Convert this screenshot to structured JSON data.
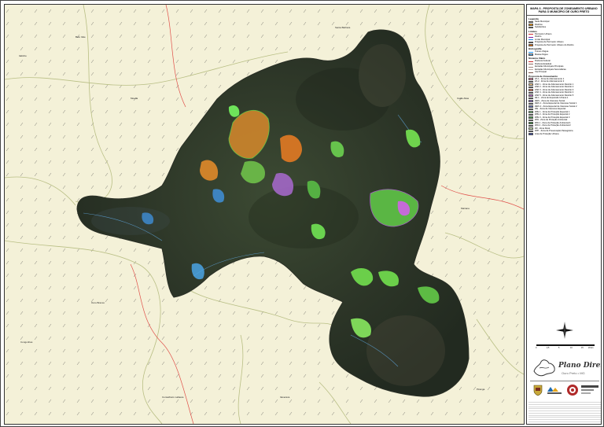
{
  "panel": {
    "title_line1": "MAPA 3 - PROPOSTA DE ZONEAMENTO URBANO",
    "title_line2": "PARA O MUNICÍPIO DE OURO PRETO"
  },
  "legend": {
    "sections": [
      {
        "head": "Legenda",
        "items": [
          {
            "label": "Sede Municipal",
            "color": "#e53935",
            "kind": "box"
          },
          {
            "label": "Distritos",
            "color": "#ff9800",
            "kind": "box"
          },
          {
            "label": "Subdistritos",
            "color": "#ffeb3b",
            "kind": "box"
          }
        ]
      },
      {
        "head": "Limites",
        "items": [
          {
            "label": "Perímetro Urbano",
            "color": "#d32f2f",
            "kind": "line"
          },
          {
            "label": "Distrito",
            "color": "#7b1fa2",
            "kind": "line"
          },
          {
            "label": "Limite Municipal",
            "color": "#1e88e5",
            "kind": "line"
          },
          {
            "label": "Proposta de Perímetro Urbano",
            "color": "#f57c00",
            "kind": "box"
          },
          {
            "label": "Proposta de Perímetro Urbano do Distrito",
            "color": "#ef6c00",
            "kind": "box"
          }
        ]
      },
      {
        "head": "Hidrografia",
        "items": [
          {
            "label": "Cursos d'água",
            "color": "#2196f3",
            "kind": "line"
          },
          {
            "label": "Massa d'água",
            "color": "#64b5f6",
            "kind": "box"
          }
        ]
      },
      {
        "head": "Sistema Viário",
        "items": [
          {
            "label": "Rodovia Federal",
            "color": "#c62828",
            "kind": "line"
          },
          {
            "label": "Rodovia Estadual",
            "color": "#8d6e63",
            "kind": "line"
          },
          {
            "label": "Estradas Municipais Principais",
            "color": "#a1887f",
            "kind": "line"
          },
          {
            "label": "Estradas Municipais Secundárias",
            "color": "#bcaaa4",
            "kind": "line"
          },
          {
            "label": "Via Principal",
            "color": "#795548",
            "kind": "line"
          }
        ]
      },
      {
        "head": "Proposta de Zoneamento",
        "items": [
          {
            "label": "ZA 1 - Zona de Adensamento 1",
            "color": "#f48fb1",
            "kind": "box"
          },
          {
            "label": "ZA 2 - Zona de Adensamento 2",
            "color": "#ce93d8",
            "kind": "box"
          },
          {
            "label": "ZAR 1 - Zona de Adensamento Restrito 1",
            "color": "#ffcc80",
            "kind": "box"
          },
          {
            "label": "ZAR 2 - Zona de Adensamento Restrito 2",
            "color": "#ffb74d",
            "kind": "box"
          },
          {
            "label": "ZAR 3 - Zona de Adensamento Restrito 3",
            "color": "#ff8a65",
            "kind": "box"
          },
          {
            "label": "ZAR 4 - Zona de Adensamento Restrito 4",
            "color": "#e57373",
            "kind": "box"
          },
          {
            "label": "ZAR 5 - Zona de Adensamento Restrito 5",
            "color": "#ba68c8",
            "kind": "box"
          },
          {
            "label": "ZE 1 - Zona de Expansão Urbana 1",
            "color": "#fff176",
            "kind": "box"
          },
          {
            "label": "ZEIS - Zona de Interesse Social",
            "color": "#9575cd",
            "kind": "box"
          },
          {
            "label": "ZEIS 1 - Zona Especial de Interesse Social 1",
            "color": "#7986cb",
            "kind": "box"
          },
          {
            "label": "ZEIS 2 - Zona Especial de Interesse Social 2",
            "color": "#5c6bc0",
            "kind": "box"
          },
          {
            "label": "ZIE - Zona de Interesse Especial",
            "color": "#4db6ac",
            "kind": "box"
          },
          {
            "label": "ZPE 1 - Zona de Proteção Especial 1",
            "color": "#81c784",
            "kind": "box"
          },
          {
            "label": "ZPE 2 - Zona de Proteção Especial 2",
            "color": "#66bb6a",
            "kind": "box"
          },
          {
            "label": "ZPE 3 - Zona de Proteção Especial 3",
            "color": "#43a047",
            "kind": "box"
          },
          {
            "label": "ZPA - Zona de Proteção Ambiental",
            "color": "#2e7d32",
            "kind": "box"
          },
          {
            "label": "ZPA 1 - Zona de Proteção Ambiental 1",
            "color": "#388e3c",
            "kind": "box"
          },
          {
            "label": "ZPA 2 - Zona de Proteção Ambiental 2",
            "color": "#1b5e20",
            "kind": "box"
          },
          {
            "label": "ZR - Zona Rural",
            "color": "#c5e1a5",
            "kind": "box"
          },
          {
            "label": "ZPP - Zona de Preservação Paisagística",
            "color": "#aed581",
            "kind": "box"
          },
          {
            "label": "Área de Proteção Urbana",
            "color": "#3949ab",
            "kind": "box"
          }
        ]
      }
    ]
  },
  "scale": {
    "labels": [
      "0",
      "2,5",
      "5",
      "10",
      "15",
      "20 km"
    ]
  },
  "branding": {
    "title": "Plano Diretor",
    "subtitle": "Ouro Preto • MG"
  },
  "map": {
    "places": [
      {
        "label": "Itabirito"
      },
      {
        "label": "Santa Bárbara"
      },
      {
        "label": "Catas Altas"
      },
      {
        "label": "Mariana"
      },
      {
        "label": "Ouro Branco"
      },
      {
        "label": "Congonhas"
      },
      {
        "label": "Conselheiro Lafaiete"
      },
      {
        "label": "Itaverava"
      },
      {
        "label": "Piranga"
      },
      {
        "label": "Belo Vale"
      },
      {
        "label": "Moeda"
      }
    ]
  }
}
